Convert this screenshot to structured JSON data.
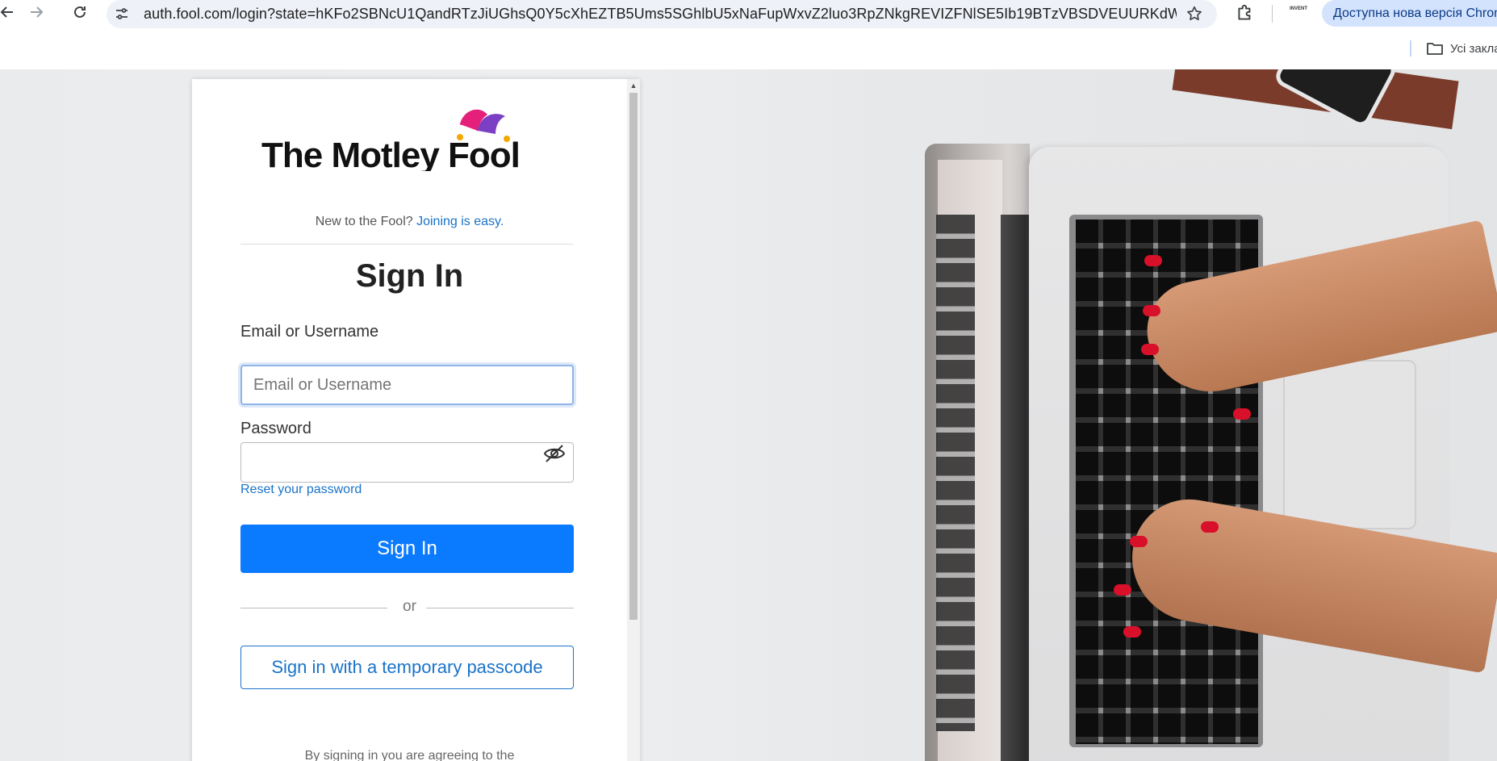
{
  "browser": {
    "url": "auth.fool.com/login?state=hKFo2SBNcU1QandRTzJiUGhsQ0Y5cXhEZTB5Ums5SGhlbU5xNaFupWxvZ2luo3RpZNkgREVIZFNlSE5Ib19BTzVBSDVEUURKdW5oME5aTkVV...",
    "update_notice": "Доступна нова версія Chrome",
    "profile_ext_label": "INVENT",
    "all_bookmarks": "Усі закла"
  },
  "login": {
    "new_prompt": "New to the Fool?",
    "join_link": "Joining is easy.",
    "title": "Sign In",
    "email_label": "Email or Username",
    "email_placeholder": "Email or Username",
    "password_label": "Password",
    "reset_link": "Reset your password",
    "sign_in_button": "Sign In",
    "or_text": "or",
    "passcode_button": "Sign in with a temporary passcode",
    "terms_text": "By signing in you are agreeing to the"
  },
  "brand": {
    "logo_text": "The Motley Fool",
    "colors": {
      "primary_button": "#0a7aff",
      "link": "#1a73c8",
      "jester_pink": "#e4207b",
      "jester_purple": "#7b3fc4",
      "jester_gold": "#f2a900"
    }
  },
  "icons": {
    "back": "arrow-left-icon",
    "forward": "arrow-right-icon",
    "reload": "reload-icon",
    "site_info": "tune-icon",
    "bookmark": "star-icon",
    "extensions": "puzzle-icon",
    "folder": "folder-icon",
    "password_visibility": "eye-off-icon"
  }
}
